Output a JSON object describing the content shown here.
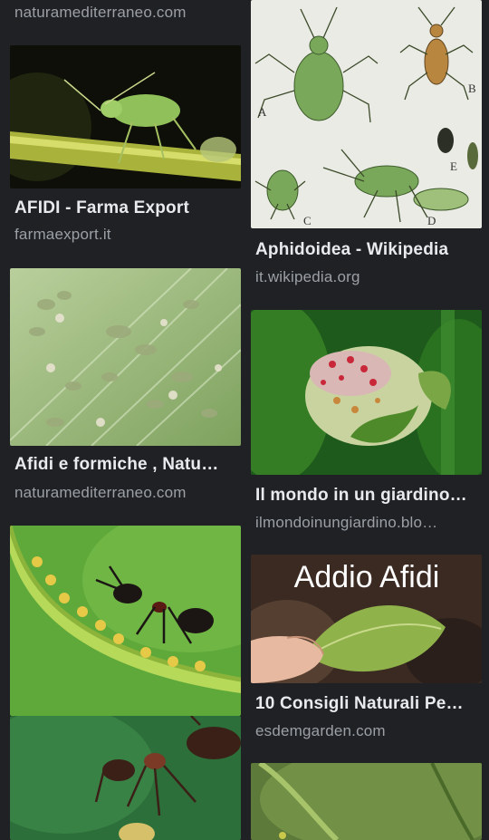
{
  "results": {
    "top_source": "naturamediterraneo.com",
    "left": [
      {
        "title": "AFIDI - Farma Export",
        "source": "farmaexport.it"
      },
      {
        "title": "Afidi e formiche , Natu…",
        "source": "naturamediterraneo.com"
      }
    ],
    "right": [
      {
        "title": "Aphidoidea - Wikipedia",
        "source": "it.wikipedia.org",
        "figure_letters": [
          "A",
          "B",
          "C",
          "D",
          "E"
        ]
      },
      {
        "title": "Il mondo in un giardino…",
        "source": "ilmondoinungiardino.blo…"
      },
      {
        "title": "10 Consigli Naturali Pe…",
        "source": "esdemgarden.com",
        "overlay_text": "Addio Afidi"
      }
    ]
  },
  "icons": {
    "aphid_image": "aphid-photo",
    "ant_image": "ant-photo"
  }
}
